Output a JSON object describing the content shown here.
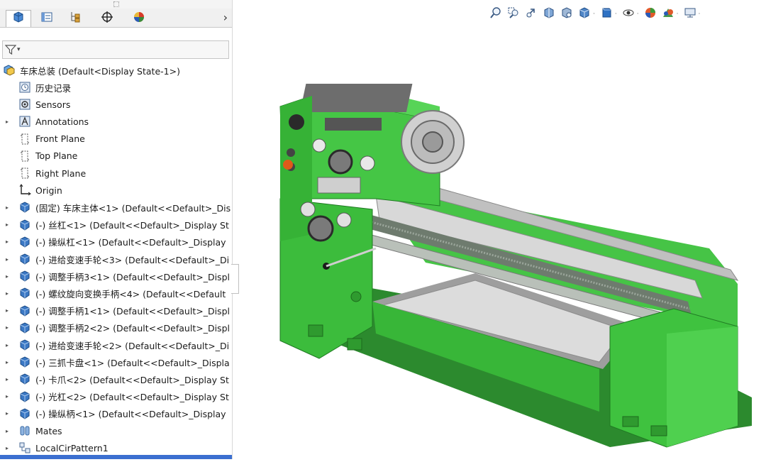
{
  "panel": {
    "tabs": [
      {
        "icon": "feature-manager-icon",
        "active": true
      },
      {
        "icon": "property-manager-icon",
        "active": false
      },
      {
        "icon": "configuration-manager-icon",
        "active": false
      },
      {
        "icon": "dimxpert-icon",
        "active": false
      },
      {
        "icon": "display-manager-icon",
        "active": false
      }
    ],
    "more_glyph": "›",
    "filter": {
      "icon": "filter-icon",
      "caret": "▾"
    }
  },
  "tree": {
    "root": {
      "label": "车床总装  (Default<Display State-1>)",
      "icon": "assembly-icon"
    },
    "items": [
      {
        "label": "历史记录",
        "icon": "history-icon",
        "expandable": false
      },
      {
        "label": "Sensors",
        "icon": "sensors-icon",
        "expandable": false
      },
      {
        "label": "Annotations",
        "icon": "annotations-icon",
        "expandable": true
      },
      {
        "label": "Front Plane",
        "icon": "plane-icon",
        "expandable": false
      },
      {
        "label": "Top Plane",
        "icon": "plane-icon",
        "expandable": false
      },
      {
        "label": "Right Plane",
        "icon": "plane-icon",
        "expandable": false
      },
      {
        "label": "Origin",
        "icon": "origin-icon",
        "expandable": false
      },
      {
        "label": "(固定) 车床主体<1> (Default<<Default>_Dis",
        "icon": "part-icon",
        "expandable": true
      },
      {
        "label": "(-) 丝杠<1> (Default<<Default>_Display St",
        "icon": "part-icon",
        "expandable": true
      },
      {
        "label": "(-) 操纵杠<1> (Default<<Default>_Display",
        "icon": "part-icon",
        "expandable": true
      },
      {
        "label": "(-) 进给变速手轮<3> (Default<<Default>_Di",
        "icon": "part-icon",
        "expandable": true
      },
      {
        "label": "(-) 调整手柄3<1> (Default<<Default>_Displ",
        "icon": "part-icon",
        "expandable": true
      },
      {
        "label": "(-) 螺纹旋向变换手柄<4> (Default<<Default",
        "icon": "part-icon",
        "expandable": true
      },
      {
        "label": "(-) 调整手柄1<1> (Default<<Default>_Displ",
        "icon": "part-icon",
        "expandable": true
      },
      {
        "label": "(-) 调整手柄2<2> (Default<<Default>_Displ",
        "icon": "part-icon",
        "expandable": true
      },
      {
        "label": "(-) 进给变速手轮<2> (Default<<Default>_Di",
        "icon": "part-icon",
        "expandable": true
      },
      {
        "label": "(-) 三抓卡盘<1> (Default<<Default>_Displa",
        "icon": "part-icon",
        "expandable": true
      },
      {
        "label": "(-) 卡爪<2> (Default<<Default>_Display St",
        "icon": "part-icon",
        "expandable": true
      },
      {
        "label": "(-) 光杠<2> (Default<<Default>_Display St",
        "icon": "part-icon",
        "expandable": true
      },
      {
        "label": "(-) 操纵柄<1> (Default<<Default>_Display",
        "icon": "part-icon",
        "expandable": true
      },
      {
        "label": "Mates",
        "icon": "mates-icon",
        "expandable": true
      },
      {
        "label": "LocalCirPattern1",
        "icon": "pattern-icon",
        "expandable": true
      }
    ]
  },
  "toolbar": {
    "buttons": [
      {
        "icon": "zoom-to-fit-icon",
        "caret": false
      },
      {
        "icon": "zoom-to-area-icon",
        "caret": false
      },
      {
        "icon": "previous-view-icon",
        "caret": false
      },
      {
        "icon": "section-view-icon",
        "caret": false
      },
      {
        "icon": "dynamic-annotation-icon",
        "caret": false
      },
      {
        "icon": "view-orientation-icon",
        "caret": true
      },
      {
        "icon": "display-style-icon",
        "caret": true
      },
      {
        "icon": "hide-show-items-icon",
        "caret": true
      },
      {
        "icon": "edit-appearance-icon",
        "caret": false
      },
      {
        "icon": "apply-scene-icon",
        "caret": true
      },
      {
        "icon": "view-settings-icon",
        "caret": true
      }
    ]
  },
  "colors": {
    "model_green": "#3ec83e",
    "model_dark": "#1f7a22",
    "accent_blue": "#3b6fd0",
    "part_icon": "#2f6fb8"
  }
}
